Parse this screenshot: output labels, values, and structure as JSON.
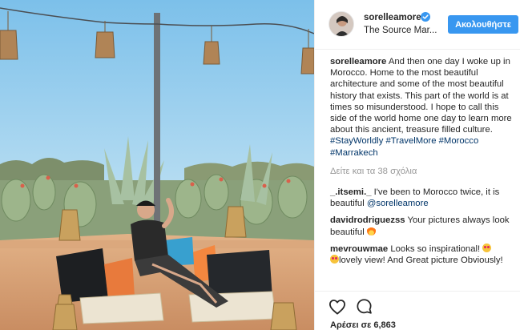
{
  "post": {
    "username": "sorelleamore",
    "location": "The Source Mar...",
    "follow_label": "Ακολουθήστε",
    "verified": true
  },
  "caption": {
    "username": "sorelleamore",
    "text": "And then one day I woke up in Morocco. Home to the most beautiful architecture and some of the most beautiful history that exists. This part of the world is at times so misunderstood. I hope to call this side of the world home one day to learn more about this ancient, treasure filled culture.",
    "hashtags": [
      "#StayWorldly",
      "#TravelMore",
      "#Morocco",
      "#Marrakech"
    ]
  },
  "view_all_comments": "Δείτε και τα 38 σχόλια",
  "comments": [
    {
      "username": "_.itsemi._",
      "text": "I've been to Morocco twice, it is beautiful",
      "mention": "@sorelleamore"
    },
    {
      "username": "davidrodriguezss",
      "text": "Your pictures always look beautiful",
      "emoji": "fire"
    },
    {
      "username": "mevrouwmae",
      "text_before": "Looks so inspirational!",
      "text_after": "lovely view! And Great picture Obviously!",
      "emoji": "heart-eyes"
    }
  ],
  "likes_label": "Αρέσει σε 6,863",
  "icons": {
    "like": "heart-icon",
    "comment": "comment-icon",
    "verified": "verified-badge-icon"
  },
  "colors": {
    "accent": "#3897f0",
    "hashtag": "#003569",
    "muted": "#999999",
    "text": "#262626",
    "border": "#efefef"
  }
}
